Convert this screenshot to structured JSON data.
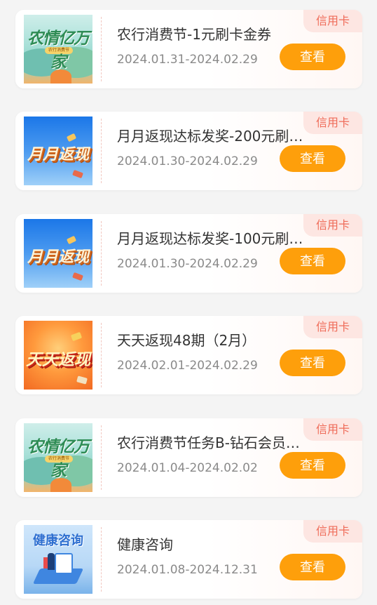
{
  "items": [
    {
      "thumb_text": "农情亿万家",
      "thumb_badge": "农行消费节",
      "tag": "信用卡",
      "title": "农行消费节-1元刷卡金券",
      "date": "2024.01.31-2024.02.29",
      "button": "查看"
    },
    {
      "thumb_text": "月月返现",
      "tag": "信用卡",
      "title": "月月返现达标发奖-200元刷…",
      "date": "2024.01.30-2024.02.29",
      "button": "查看"
    },
    {
      "thumb_text": "月月返现",
      "tag": "信用卡",
      "title": "月月返现达标发奖-100元刷…",
      "date": "2024.01.30-2024.02.29",
      "button": "查看"
    },
    {
      "thumb_text": "天天返现",
      "tag": "信用卡",
      "title": "天天返现48期（2月）",
      "date": "2024.02.01-2024.02.29",
      "button": "查看"
    },
    {
      "thumb_text": "农情亿万家",
      "thumb_badge": "农行消费节",
      "tag": "信用卡",
      "title": "农行消费节任务B-钻石会员…",
      "date": "2024.01.04-2024.02.02",
      "button": "查看"
    },
    {
      "thumb_text": "健康咨询",
      "tag": "信用卡",
      "title": "健康咨询",
      "date": "2024.01.08-2024.12.31",
      "button": "查看"
    }
  ],
  "colors": {
    "button_bg": "#fe9f0b",
    "tag_bg": "#fde6e2",
    "tag_text": "#ef6b58",
    "title_text": "#333333",
    "date_text": "#8a8a8a"
  }
}
